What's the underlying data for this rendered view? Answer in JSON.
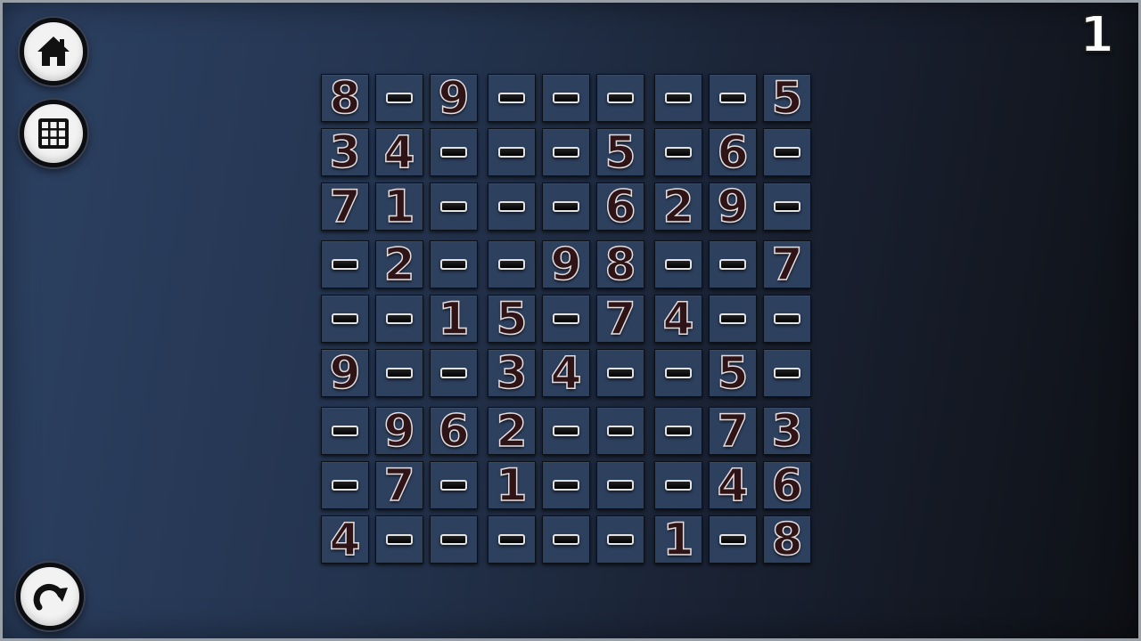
{
  "level_number": "1",
  "buttons": {
    "home_icon": "house-icon",
    "grid_icon": "grid-icon",
    "undo_icon": "redo-arrow-icon"
  },
  "colors": {
    "cell_bg": "#2d405e",
    "digit_fill": "#2e1416",
    "digit_outline": "#e6dede"
  },
  "board": [
    [
      "8",
      "",
      "9",
      "",
      "",
      "",
      "",
      "",
      "5"
    ],
    [
      "3",
      "4",
      "",
      "",
      "",
      "5",
      "",
      "6",
      ""
    ],
    [
      "7",
      "1",
      "",
      "",
      "",
      "6",
      "2",
      "9",
      ""
    ],
    [
      "",
      "2",
      "",
      "",
      "9",
      "8",
      "",
      "",
      "7"
    ],
    [
      "",
      "",
      "1",
      "5",
      "",
      "7",
      "4",
      "",
      ""
    ],
    [
      "9",
      "",
      "",
      "3",
      "4",
      "",
      "",
      "5",
      ""
    ],
    [
      "",
      "9",
      "6",
      "2",
      "",
      "",
      "",
      "7",
      "3"
    ],
    [
      "",
      "7",
      "",
      "1",
      "",
      "",
      "",
      "4",
      "6"
    ],
    [
      "4",
      "",
      "",
      "",
      "",
      "",
      "1",
      "",
      "8"
    ]
  ]
}
